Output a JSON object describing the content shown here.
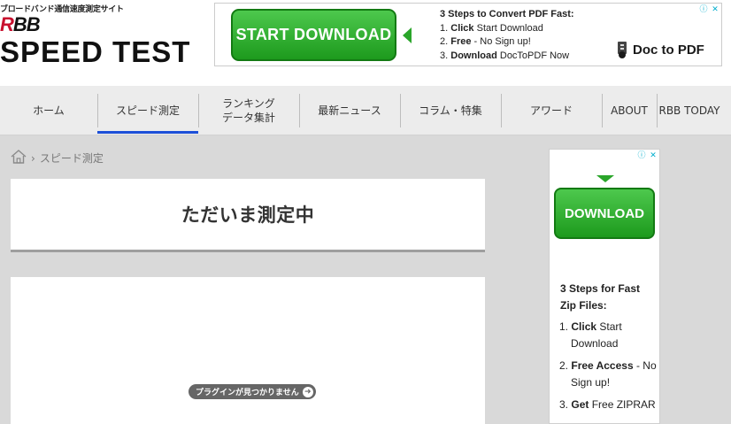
{
  "header": {
    "tagline": "ブロードバンド通信速度測定サイト",
    "logo_rbb_r": "R",
    "logo_rbb_rest": "BB",
    "logo_speed": "SPEED TEST"
  },
  "ad_top": {
    "button": "START DOWNLOAD",
    "title": "3 Steps to Convert PDF Fast:",
    "steps": [
      {
        "num": "1.",
        "bold": "Click",
        "rest": " Start Download"
      },
      {
        "num": "2.",
        "bold": "Free",
        "rest": " - No Sign up!"
      },
      {
        "num": "3.",
        "bold": "Download",
        "rest": " DocToPDF Now"
      }
    ],
    "brand": "Doc to PDF",
    "info_badge": "ⓘ",
    "close_badge": "✕"
  },
  "nav": {
    "items": [
      {
        "label": "ホーム"
      },
      {
        "label": "スピード測定"
      },
      {
        "label": "ランキング\nデータ集計"
      },
      {
        "label": "最新ニュース"
      },
      {
        "label": "コラム・特集"
      },
      {
        "label": "アワード"
      },
      {
        "label": "ABOUT"
      },
      {
        "label": "RBB TODAY"
      }
    ],
    "active_index": 1,
    "accent": "#1c4fd8"
  },
  "breadcrumb": {
    "separator": "›",
    "current": "スピード測定"
  },
  "main": {
    "status_title": "ただいま測定中",
    "plugin_message": "プラグインが見つかりません",
    "plugin_arrow": "➜"
  },
  "ad_side": {
    "button": "DOWNLOAD",
    "heading": "3 Steps for Fast Zip Files:",
    "steps": [
      {
        "num": "1.",
        "bold": "Click",
        "rest": " Start Download"
      },
      {
        "num": "2.",
        "bold": "Free Access",
        "rest": " - No Sign up!"
      },
      {
        "num": "3.",
        "bold": "Get",
        "rest": " Free ZIPRAR"
      }
    ],
    "info_badge": "ⓘ",
    "close_badge": "✕"
  },
  "colors": {
    "download_green": "#2aa52a",
    "logo_red": "#c8102e",
    "page_bg": "#d9d9d9"
  }
}
